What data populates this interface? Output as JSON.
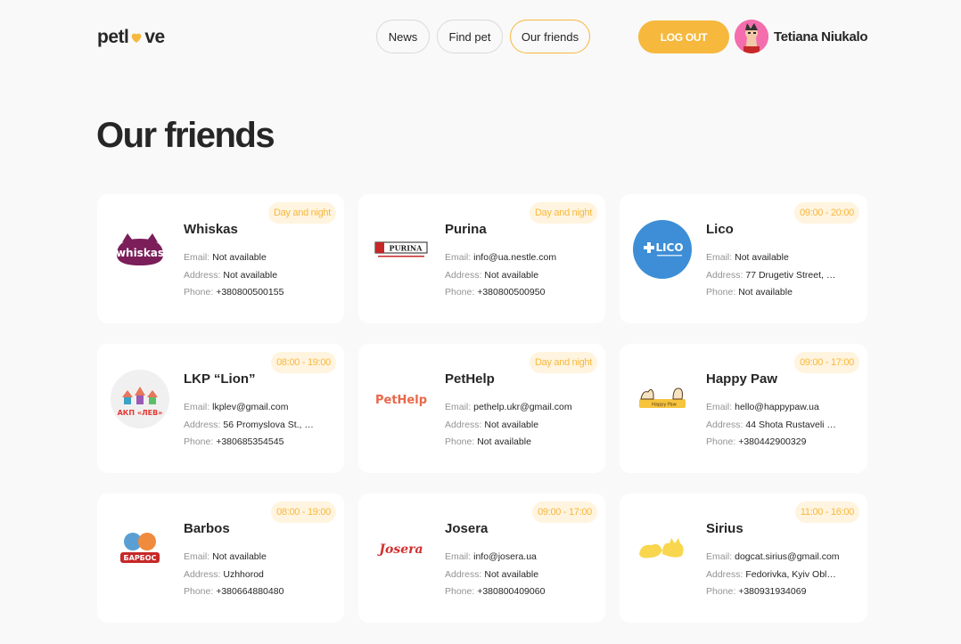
{
  "header": {
    "logo_left": "petl",
    "logo_right": "ve",
    "nav": [
      {
        "label": "News"
      },
      {
        "label": "Find pet"
      },
      {
        "label": "Our friends"
      }
    ],
    "logout_label": "LOG OUT",
    "user_name": "Tetiana Niukalo"
  },
  "page_title": "Our friends",
  "labels": {
    "email": "Email:",
    "address": "Address:",
    "phone": "Phone:"
  },
  "friends": [
    {
      "name": "Whiskas",
      "hours": "Day and night",
      "email": "Not available",
      "address": "Not available",
      "phone": "+380800500155",
      "logo_text": "whiskas"
    },
    {
      "name": "Purina",
      "hours": "Day and night",
      "email": "info@ua.nestle.com",
      "address": "Not available",
      "phone": "+380800500950",
      "logo_text": "PURINA"
    },
    {
      "name": "Lico",
      "hours": "09:00 - 20:00",
      "email": "Not available",
      "address": "77 Drugetiv Street, U...",
      "phone": "Not available",
      "logo_text": "LICO"
    },
    {
      "name": "LKP “Lion”",
      "hours": "08:00 - 19:00",
      "email": "lkplev@gmail.com",
      "address": "56 Promyslova St., Lv...",
      "phone": "+380685354545",
      "logo_text": "АКП «ЛЕВ»"
    },
    {
      "name": "PetHelp",
      "hours": "Day and night",
      "email": "pethelp.ukr@gmail.com",
      "address": "Not available",
      "phone": "Not available",
      "logo_text": "PetHelp"
    },
    {
      "name": "Happy Paw",
      "hours": "09:00 - 17:00",
      "email": "hello@happypaw.ua",
      "address": "44 Shota Rustaveli S...",
      "phone": "+380442900329",
      "logo_text": "Happy Paw"
    },
    {
      "name": "Barbos",
      "hours": "08:00 - 19:00",
      "email": "Not available",
      "address": "Uzhhorod",
      "phone": "+380664880480",
      "logo_text": "БАРБОС"
    },
    {
      "name": "Josera",
      "hours": "09:00 - 17:00",
      "email": "info@josera.ua",
      "address": "Not available",
      "phone": "+380800409060",
      "logo_text": "Josera"
    },
    {
      "name": "Sirius",
      "hours": "11:00 - 16:00",
      "email": "dogcat.sirius@gmail.com",
      "address": "Fedorivka, Kyiv Oblas...",
      "phone": "+380931934069",
      "logo_text": ""
    }
  ]
}
